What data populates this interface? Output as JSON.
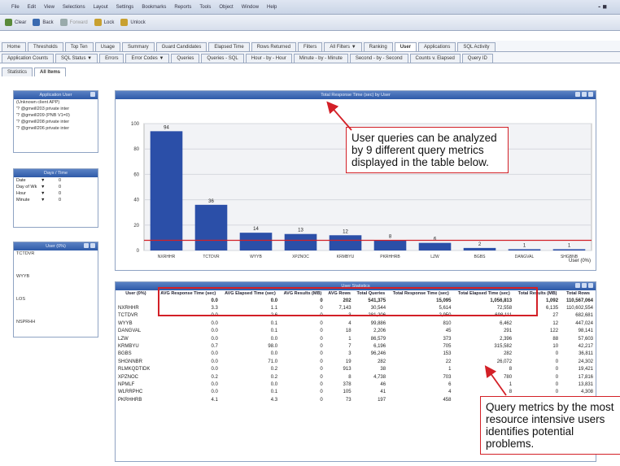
{
  "menu": [
    "File",
    "Edit",
    "View",
    "Selections",
    "Layout",
    "Settings",
    "Bookmarks",
    "Reports",
    "Tools",
    "Object",
    "Window",
    "Help"
  ],
  "window_control": "- ■",
  "toolbar": [
    {
      "label": "Clear",
      "icon": "clear-icon",
      "color": "#5a8a3a"
    },
    {
      "label": "Back",
      "icon": "back-icon",
      "color": "#3a6ab0"
    },
    {
      "label": "Forward",
      "icon": "forward-icon",
      "color": "#9aa"
    },
    {
      "label": "Lock",
      "icon": "lock-icon",
      "color": "#c8a030"
    },
    {
      "label": "Unlock",
      "icon": "unlock-icon",
      "color": "#c8a030"
    }
  ],
  "tabs_row1": [
    "Home",
    "Thresholds",
    "Top Ten",
    "Usage",
    "Summary",
    "Guard Candidates",
    "Elapsed Time",
    "Rows Returned",
    "Filters",
    "All Filters ▼",
    "Ranking",
    "User",
    "Applications",
    "SQL Activity"
  ],
  "active_tab_row1": "User",
  "tabs_row2": [
    "Application Counts",
    "SQL Status ▼",
    "Errors",
    "Error Codes ▼",
    "Queries",
    "Queries - SQL",
    "Hour - by - Hour",
    "Minute - by - Minute",
    "Second - by - Second",
    "Counts v. Elapsed",
    "Query ID"
  ],
  "tabs_row3": [
    "Statistics",
    "All Items"
  ],
  "active_tab_row3": "All Items",
  "application_panel": {
    "title": "Application User",
    "items": [
      "(Unknown client APP)",
      "'? @gmeill203 private inter",
      "'? @gmeill209 (PNB V1=0)",
      "'? @gmeill208 private inter",
      "'? @gmeill206 private inter"
    ]
  },
  "days_panel": {
    "title": "Days / Time",
    "rows": [
      [
        "Date",
        "▼",
        "0"
      ],
      [
        "Day of Wk",
        "▼",
        "0"
      ],
      [
        "Hour",
        "▼",
        "0"
      ],
      [
        "Minute",
        "▼",
        "0"
      ]
    ]
  },
  "user_panel": {
    "title": "User (0%)",
    "items": [
      "TCTDVR",
      "WYYB",
      "LOS",
      "NSPRHH"
    ]
  },
  "chart_panel": {
    "title": "Total Response Time (sec) by User",
    "legend": "User (0%)"
  },
  "chart_data": {
    "type": "bar",
    "categories": [
      "NXRHHR",
      "TCTDVR",
      "WYYB",
      "XPZNOC",
      "KRMBYU",
      "PKRHHRB",
      "LZW",
      "BGBS",
      "DANGVAL",
      "SHGBNB"
    ],
    "values": [
      94,
      36,
      14,
      13,
      12,
      8,
      6,
      2,
      1,
      1
    ],
    "ylim": [
      0,
      100
    ],
    "yticks": [
      0,
      20,
      40,
      60,
      80,
      100
    ],
    "threshold": 8,
    "grid": true,
    "colors": {
      "bar": "#2b4fa8",
      "threshold": "#d32027"
    }
  },
  "table_panel": {
    "title": "User Statistics",
    "headers": [
      "User (0%)",
      "AVG Response Time (sec)",
      "AVG Elapsed Time (sec)",
      "AVG Results (MB)",
      "AVG Rows",
      "Total Queries",
      "Total Response Time (sec)",
      "Total Elapsed Time (sec)",
      "Total Results (MB)",
      "Total Rows"
    ],
    "totals": [
      "",
      "0.0",
      "0.0",
      "0",
      "202",
      "541,375",
      "15,095",
      "1,056,813",
      "1,092",
      "110,567,064"
    ],
    "rows": [
      [
        "NXRHHR",
        "3.3",
        "1.1",
        "0",
        "7,143",
        "30,544",
        "5,614",
        "72,558",
        "6,135",
        "110,602,554"
      ],
      [
        "TCTDVR",
        "0.0",
        "2.6",
        "0",
        "3",
        "281,206",
        "2,950",
        "698,111",
        "27",
        "682,681"
      ],
      [
        "WYYB",
        "0.0",
        "0.1",
        "0",
        "4",
        "99,886",
        "810",
        "6,462",
        "12",
        "447,024"
      ],
      [
        "DANGVAL",
        "0.0",
        "0.1",
        "0",
        "18",
        "2,206",
        "45",
        "291",
        "122",
        "98,141"
      ],
      [
        "LZW",
        "0.0",
        "0.0",
        "0",
        "1",
        "86,579",
        "373",
        "2,396",
        "88",
        "57,603"
      ],
      [
        "KRMBYU",
        "0.7",
        "98.0",
        "0",
        "7",
        "6,196",
        "705",
        "315,582",
        "10",
        "42,217"
      ],
      [
        "BGBS",
        "0.0",
        "0.0",
        "0",
        "3",
        "96,246",
        "153",
        "282",
        "0",
        "36,811"
      ],
      [
        "SHGNNBR",
        "0.0",
        "71.0",
        "0",
        "19",
        "282",
        "22",
        "26,072",
        "0",
        "24,302"
      ],
      [
        "RLMKQDTIDK",
        "0.0",
        "0.2",
        "0",
        "913",
        "38",
        "1",
        "8",
        "0",
        "19,421"
      ],
      [
        "XPZNOC",
        "0.2",
        "0.2",
        "0",
        "8",
        "4,738",
        "703",
        "780",
        "0",
        "17,816"
      ],
      [
        "NPMLF",
        "0.0",
        "0.0",
        "0",
        "378",
        "46",
        "6",
        "1",
        "0",
        "13,831"
      ],
      [
        "WLRRPHC",
        "0.0",
        "0.1",
        "0",
        "105",
        "41",
        "4",
        "8",
        "0",
        "4,308"
      ],
      [
        "PKRHHRB",
        "4.1",
        "4.3",
        "0",
        "73",
        "197",
        "458",
        "856",
        "0",
        "7,745"
      ]
    ]
  },
  "callouts": {
    "top": "User queries can be analyzed by 9 different query metrics displayed in the table below.",
    "bottom": "Query metrics by the most resource intensive users identifies potential problems."
  }
}
